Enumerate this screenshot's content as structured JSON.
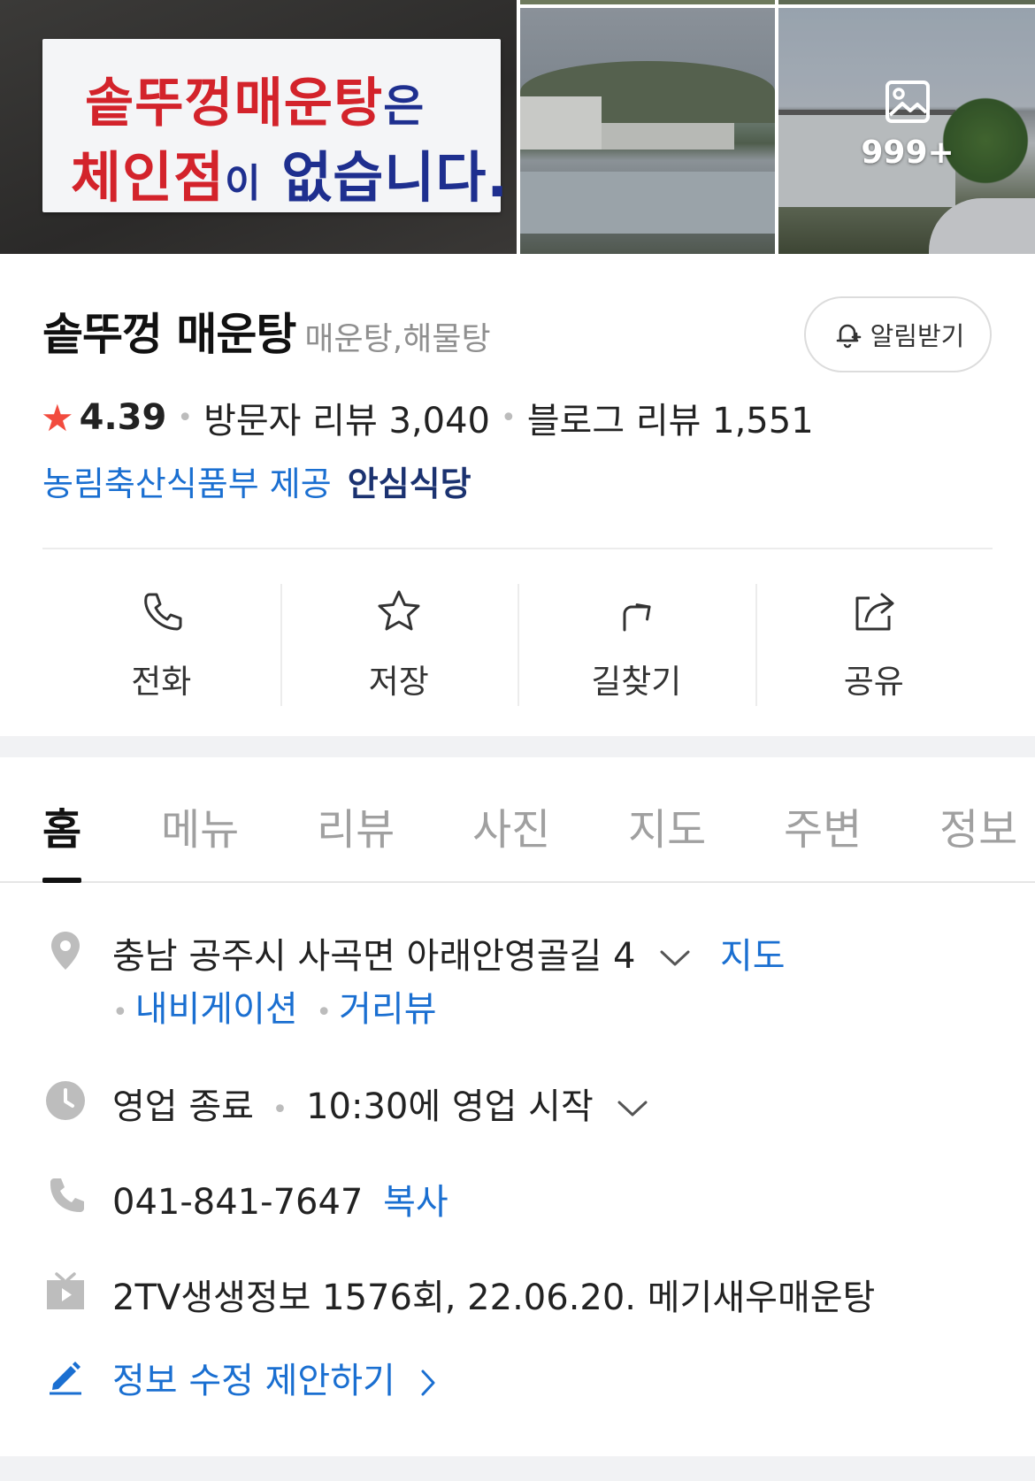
{
  "photos": {
    "sign_line1_red": "솥뚜껑매운탕",
    "sign_line1_navy": "은",
    "sign_line2_red": "체인점",
    "sign_line2_navy1": "이",
    "sign_line2_navy2": " 없습니다.",
    "more_count": "999+"
  },
  "place": {
    "name": "솥뚜껑 매운탕",
    "category": "매운탕,해물탕",
    "notify_label": "알림받기",
    "rating": "4.39",
    "visitor_reviews": "방문자 리뷰 3,040",
    "blog_reviews": "블로그 리뷰 1,551",
    "provider": "농림축산식품부 제공",
    "safe_badge": "안심식당"
  },
  "actions": {
    "call": "전화",
    "save": "저장",
    "directions": "길찾기",
    "share": "공유"
  },
  "tabs": [
    "홈",
    "메뉴",
    "리뷰",
    "사진",
    "지도",
    "주변",
    "정보"
  ],
  "info": {
    "address": "충남 공주시 사곡면 아래안영골길 4",
    "map_link": "지도",
    "navigation_link": "내비게이션",
    "streetview_link": "거리뷰",
    "status": "영업 종료",
    "hours": "10:30에 영업 시작",
    "phone": "041-841-7647",
    "copy_link": "복사",
    "tv": "2TV생생정보 1576회, 22.06.20. 메기새우매운탕",
    "suggest_edit": "정보 수정 제안하기"
  },
  "colors": {
    "accent_blue": "#1a6fd1",
    "star_red": "#f24b3e",
    "badge_navy": "#1b3270"
  }
}
